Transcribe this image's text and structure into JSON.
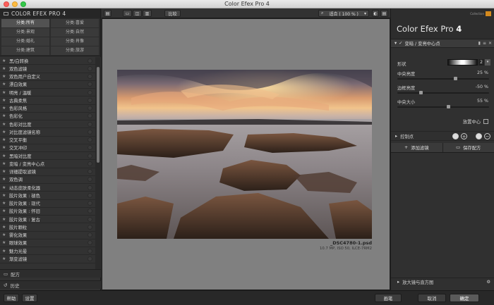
{
  "window": {
    "title": "Color Efex Pro 4"
  },
  "left_panel": {
    "header": "COLOR EFEX PRO 4",
    "categories": [
      "分类:所有",
      "分类:喜爱",
      "分类:景观",
      "分类:自然",
      "分类:婚礼",
      "分类:肖像",
      "分类:建筑",
      "分类:旅游"
    ],
    "filters": [
      "黑/白转换",
      "双色滤镜",
      "双色用户自定义",
      "漂白效果",
      "明亮 / 温暖",
      "古典柔焦",
      "色彩风格",
      "色彩化",
      "色彩对比度",
      "对比度滤镜名称",
      "交叉平衡",
      "交叉冲印",
      "黑暗对比度",
      "变暗 / 变亮中心点",
      "详细提取滤镜",
      "双色调",
      "动态皮肤柔化器",
      "胶片效果 : 褪色",
      "胶片效果 : 现代",
      "胶片效果 : 怀旧",
      "胶片效果 : 复古",
      "胶片颗粒",
      "雾化效果",
      "眼球效果",
      "魅力光晕",
      "渐变滤镜"
    ],
    "sections": {
      "recipes": "配方",
      "history": "历史"
    }
  },
  "toolbar": {
    "compare": "比较",
    "zoom": "适合 ( 100 % )"
  },
  "preview": {
    "filename": "_DSC4780-1.psd",
    "info": "10.7 MP, ISO 50, ILCE-7RM2"
  },
  "right_panel": {
    "brand_small": "Collection",
    "app_name": "Color Efex Pro",
    "app_version": "4",
    "filter_header": "变暗 / 变亮中心点",
    "shape_label": "形状",
    "shape_value": "2",
    "controls": [
      {
        "label": "中央亮度",
        "value": "25 %",
        "pos": 0.63
      },
      {
        "label": "边框亮度",
        "value": "-50 %",
        "pos": 0.25
      },
      {
        "label": "中央大小",
        "value": "55 %",
        "pos": 0.55
      }
    ],
    "place_center": "放置中心",
    "control_points": "控制点",
    "add_filter": "添加滤镜",
    "save_recipe": "保存配方",
    "loupe": "放大镜与直方图"
  },
  "bottom": {
    "help": "帮助",
    "settings": "设置",
    "brush": "画笔",
    "cancel": "取消",
    "ok": "确定"
  }
}
